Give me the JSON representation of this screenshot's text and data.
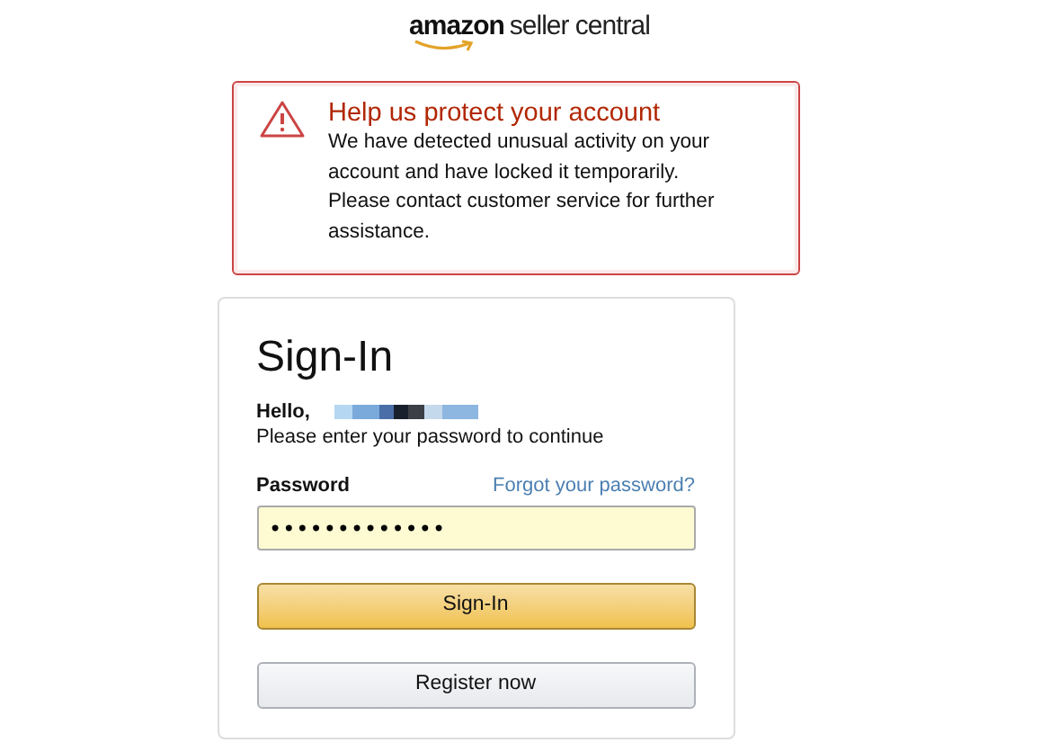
{
  "logo": {
    "brand": "amazon",
    "product": "seller central"
  },
  "alert": {
    "title": "Help us protect your account",
    "message": "We have detected unusual activity on your account and have locked it temporarily. Please contact customer service for further assistance."
  },
  "signin": {
    "title": "Sign-In",
    "greeting": "Hello,",
    "instruction": "Please enter your password to continue",
    "password_label": "Password",
    "forgot_link": "Forgot your password?",
    "password_value": "•••••••••••••",
    "submit_button": "Sign-In",
    "register_button": "Register now"
  }
}
